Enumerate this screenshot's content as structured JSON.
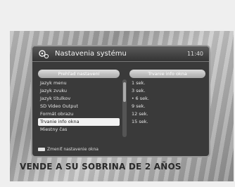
{
  "osd": {
    "title": "Nastavenia systému",
    "time": "11:40",
    "icon": "gear-icon"
  },
  "left_column": {
    "header": "Prehľad nastavení",
    "items": [
      {
        "label": "Jazyk menu"
      },
      {
        "label": "Jazyk zvuku"
      },
      {
        "label": "Jazyk titulkov"
      },
      {
        "label": "SD Video Output"
      },
      {
        "label": "Formát obrazu"
      },
      {
        "label": "Trvanie info okna",
        "selected": true
      },
      {
        "label": "Miestny čas"
      }
    ]
  },
  "right_column": {
    "header": "Trvanie info okna",
    "options": [
      {
        "label": "1 sek."
      },
      {
        "label": "3 sek."
      },
      {
        "label": "6 sek.",
        "checked": true
      },
      {
        "label": "9 sek."
      },
      {
        "label": "12 sek."
      },
      {
        "label": "15 sek."
      }
    ]
  },
  "footer": {
    "hint": "Zmeniť nastavenie okna"
  },
  "caption": "VENDE A SU SOBRINA DE 2 AÑOS"
}
